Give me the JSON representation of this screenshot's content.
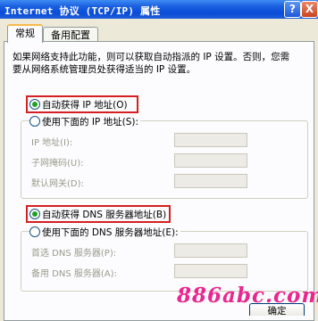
{
  "window": {
    "title": "Internet 协议 (TCP/IP) 属性",
    "help_label": "?",
    "close_label": "X"
  },
  "tabs": [
    {
      "label": "常规",
      "selected": true
    },
    {
      "label": "备用配置",
      "selected": false
    }
  ],
  "description": "如果网络支持此功能，则可以获取自动指派的 IP 设置。否则，您需要从网络系统管理员处获得适当的 IP 设置。",
  "ip_section": {
    "auto_label": "自动获得 IP 地址(O)",
    "auto_selected": true,
    "manual_label": "使用下面的 IP 地址(S):",
    "manual_selected": false,
    "fields": [
      {
        "label": "IP 地址(I):",
        "value": ""
      },
      {
        "label": "子网掩码(U):",
        "value": ""
      },
      {
        "label": "默认网关(D):",
        "value": ""
      }
    ]
  },
  "dns_section": {
    "auto_label": "自动获得 DNS 服务器地址(B)",
    "auto_selected": true,
    "manual_label": "使用下面的 DNS 服务器地址(E):",
    "manual_selected": false,
    "fields": [
      {
        "label": "首选 DNS 服务器(P):",
        "value": ""
      },
      {
        "label": "备用 DNS 服务器(A):",
        "value": ""
      }
    ]
  },
  "watermark": "886abc.com",
  "ok_label": "确定"
}
